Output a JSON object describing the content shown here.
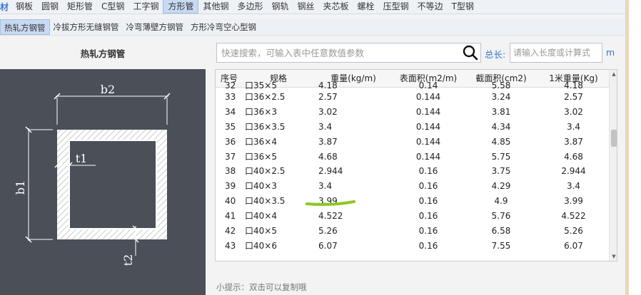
{
  "top_tabs": {
    "lead": "材",
    "items": [
      {
        "label": "钢板",
        "active": false
      },
      {
        "label": "圆钢",
        "active": false
      },
      {
        "label": "矩形管",
        "active": false
      },
      {
        "label": "C型钢",
        "active": false
      },
      {
        "label": "工字钢",
        "active": false
      },
      {
        "label": "方形管",
        "active": true
      },
      {
        "label": "其他钢",
        "active": false
      },
      {
        "label": "多边形",
        "active": false
      },
      {
        "label": "钢轨",
        "active": false
      },
      {
        "label": "钢丝",
        "active": false
      },
      {
        "label": "夹芯板",
        "active": false
      },
      {
        "label": "螺栓",
        "active": false
      },
      {
        "label": "压型钢",
        "active": false
      },
      {
        "label": "不等边",
        "active": false
      },
      {
        "label": "T型钢",
        "active": false
      }
    ]
  },
  "sub_tabs": [
    {
      "label": "热轧方钢管",
      "active": true
    },
    {
      "label": "冷拔方形无缝钢管",
      "active": false
    },
    {
      "label": "冷弯薄壁方钢管",
      "active": false
    },
    {
      "label": "方形冷弯空心型钢",
      "active": false
    }
  ],
  "panel": {
    "title": "热轧方钢管"
  },
  "diagram": {
    "label_b2": "b2",
    "label_b1": "b1",
    "label_t1": "t1",
    "label_t2": "t2"
  },
  "search": {
    "placeholder": "快速搜索，可输入表中任意数值参数",
    "length_label": "总长:",
    "length_placeholder": "请输入长度或计算式",
    "length_unit": "m"
  },
  "table": {
    "headers": [
      "序号",
      "规格",
      "重量(kg/m)",
      "表面积(m2/m)",
      "截面积(cm2)",
      "1米重量(Kg)"
    ],
    "partial_row": [
      "32",
      "口35×5",
      "4.18",
      "0.14",
      "5.58",
      "4.18"
    ],
    "rows": [
      [
        "33",
        "口36×2.5",
        "2.57",
        "0.144",
        "3.24",
        "2.57"
      ],
      [
        "34",
        "口36×3",
        "3.02",
        "0.144",
        "3.81",
        "3.02"
      ],
      [
        "35",
        "口36×3.5",
        "3.4",
        "0.144",
        "4.34",
        "3.4"
      ],
      [
        "36",
        "口36×4",
        "3.87",
        "0.144",
        "4.85",
        "3.87"
      ],
      [
        "37",
        "口36×5",
        "4.68",
        "0.144",
        "5.75",
        "4.68"
      ],
      [
        "38",
        "口40×2.5",
        "2.944",
        "0.16",
        "3.75",
        "2.944"
      ],
      [
        "39",
        "口40×3",
        "3.4",
        "0.16",
        "4.29",
        "3.4"
      ],
      [
        "40",
        "口40×3.5",
        "3.99",
        "0.16",
        "4.9",
        "3.99"
      ],
      [
        "41",
        "口40×4",
        "4.522",
        "0.16",
        "5.76",
        "4.522"
      ],
      [
        "42",
        "口40×5",
        "5.26",
        "0.16",
        "6.58",
        "5.26"
      ],
      [
        "43",
        "口40×6",
        "6.07",
        "0.16",
        "7.55",
        "6.07"
      ]
    ]
  },
  "hint": "小提示：双击可以复制哦",
  "colors": {
    "accent": "#2d7ac8",
    "active_tab": "#c8daf2",
    "diagram_bg": "#4a4f58",
    "highlight_mark": "#8cc820"
  }
}
